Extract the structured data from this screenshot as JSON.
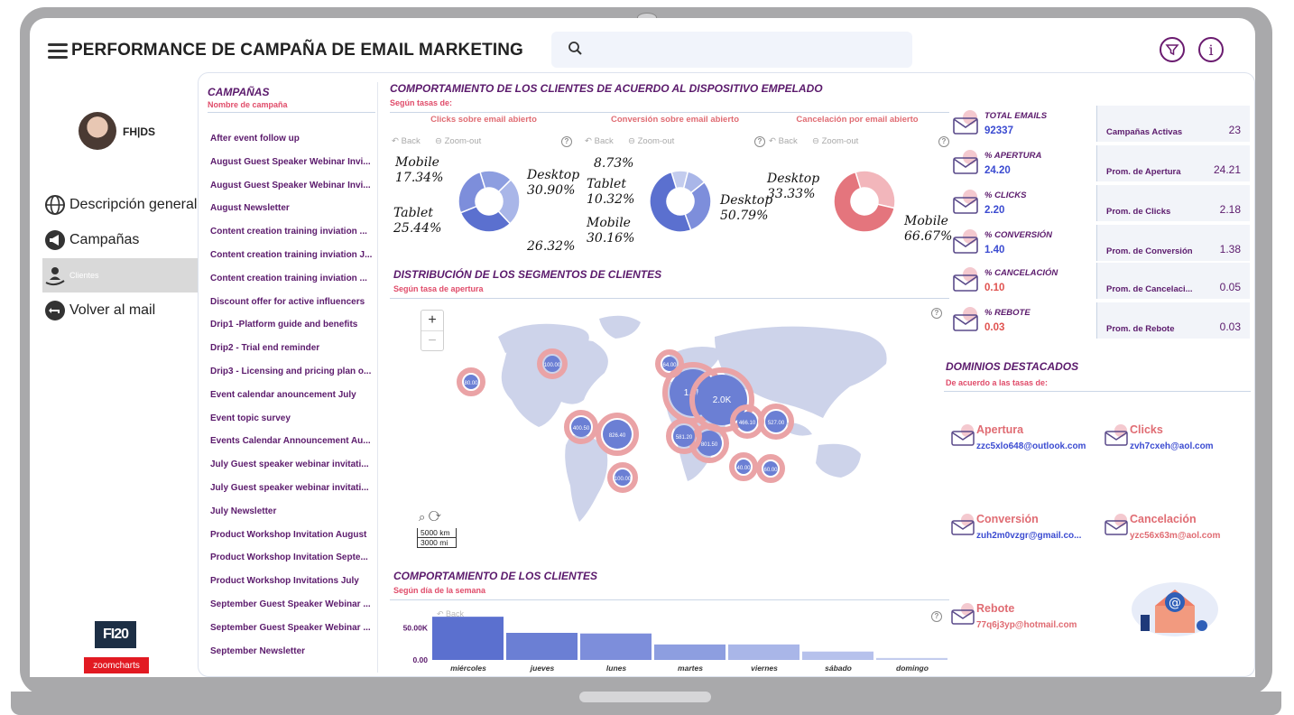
{
  "header": {
    "title": "PERFORMANCE DE CAMPAÑA DE EMAIL MARKETING",
    "search_placeholder": ""
  },
  "user": {
    "name": "FH|DS"
  },
  "nav": [
    {
      "label": "Descripción general",
      "icon": "globe-icon"
    },
    {
      "label": "Campañas",
      "icon": "megaphone-icon"
    },
    {
      "label": "Clientes",
      "icon": "clients-icon",
      "active": true
    },
    {
      "label": "Volver al mail",
      "icon": "back-arrow-icon"
    }
  ],
  "brand": {
    "logo1": "FI20",
    "logo2": "zoomcharts"
  },
  "campaigns": {
    "title": "CAMPAÑAS",
    "subtitle": "Nombre de campaña",
    "items": [
      "After event follow up",
      "August Guest Speaker Webinar Invi...",
      "August Guest Speaker Webinar Invi...",
      "August Newsletter",
      "Content creation training inviation ...",
      "Content creation training inviation J...",
      "Content creation training inviation ...",
      "Discount offer for active influencers",
      "Drip1 -Platform guide and benefits",
      "Drip2 - Trial end reminder",
      "Drip3 - Licensing and pricing plan o...",
      "Event calendar anouncement July",
      "Event topic survey",
      "Events Calendar Announcement Au...",
      "July Guest speaker webinar invitati...",
      "July Guest speaker webinar invitati...",
      "July Newsletter",
      "Product Workshop Invitation August",
      "Product Workshop Invitation Septe...",
      "Product Workshop Invitations July",
      "September Guest Speaker Webinar ...",
      "September Guest Speaker Webinar ...",
      "September Newsletter"
    ]
  },
  "device_section": {
    "title": "COMPORTAMIENTO DE LOS CLIENTES DE ACUERDO AL DISPOSITIVO EMPELADO",
    "subtitle": "Según tasas de:",
    "back_label": "Back",
    "zoom_out_label": "Zoom-out",
    "help": "?",
    "donuts": [
      {
        "heading": "Clicks sobre email abierto",
        "labels": [
          {
            "name": "Mobile",
            "value": "17.34%"
          },
          {
            "name": "Tablet",
            "value": "25.44%"
          },
          {
            "name": "Desktop",
            "value": "30.90%"
          },
          {
            "name": "",
            "value": "26.32%"
          }
        ]
      },
      {
        "heading": "Conversión sobre email abierto",
        "labels": [
          {
            "name": "",
            "value": "8.73%"
          },
          {
            "name": "Tablet",
            "value": "10.32%"
          },
          {
            "name": "Mobile",
            "value": "30.16%"
          },
          {
            "name": "Desktop",
            "value": "50.79%"
          }
        ]
      },
      {
        "heading": "Cancelación por email abierto",
        "labels": [
          {
            "name": "Desktop",
            "value": "33.33%"
          },
          {
            "name": "Mobile",
            "value": "66.67%"
          }
        ]
      }
    ]
  },
  "map_section": {
    "title": "DISTRIBUCIÓN DE LOS SEGMENTOS DE CLIENTES",
    "subtitle": "Según tasa de apertura",
    "zoom_in": "+",
    "zoom_out": "−",
    "scale_km": "5000 km",
    "scale_mi": "3000 mi",
    "bubble_labels": [
      "1.9K",
      "2.0K",
      "826.40",
      "801.50",
      "581.20",
      "527.00",
      "466.10",
      "400.50",
      "100.00",
      "100.00",
      "80.00",
      "64.00",
      "60.00",
      "40.00"
    ]
  },
  "weekday_section": {
    "title": "COMPORTAMIENTO DE LOS CLIENTES",
    "subtitle": "Según día de la semana",
    "back_label": "Back"
  },
  "kpis": [
    {
      "label": "TOTAL EMAILS",
      "value": "92337",
      "card_label": "Campañas Activas",
      "card_value": "23",
      "color": "#3b4bd1"
    },
    {
      "label": "% APERTURA",
      "value": "24.20",
      "card_label": "Prom. de Apertura",
      "card_value": "24.21",
      "color": "#3b4bd1"
    },
    {
      "label": "% CLICKS",
      "value": "2.20",
      "card_label": "Prom. de Clicks",
      "card_value": "2.18",
      "color": "#3b4bd1"
    },
    {
      "label": "% CONVERSIÓN",
      "value": "1.40",
      "card_label": "Prom. de Conversión",
      "card_value": "1.38",
      "color": "#3b4bd1"
    },
    {
      "label": "% CANCELACIÓN",
      "value": "0.10",
      "card_label": "Prom. de Cancelaci...",
      "card_value": "0.05",
      "color": "#e0524f"
    },
    {
      "label": "% REBOTE",
      "value": "0.03",
      "card_label": "Prom. de Rebote",
      "card_value": "0.03",
      "color": "#e0524f"
    }
  ],
  "domains": {
    "title": "DOMINIOS DESTACADOS",
    "subtitle": "De acuerdo a las tasas de:",
    "items": [
      {
        "label": "Apertura",
        "email": "zzc5xlo648@outlook.com",
        "color": "#3b4bd1"
      },
      {
        "label": "Clicks",
        "email": "zvh7cxeh@aol.com",
        "color": "#3b4bd1"
      },
      {
        "label": "Conversión",
        "email": "zuh2m0vzgr@gmail.co...",
        "color": "#3b4bd1"
      },
      {
        "label": "Cancelación",
        "email": "yzc56x63m@aol.com",
        "color": "#e06c73"
      },
      {
        "label": "Rebote",
        "email": "77q6j3yp@hotmail.com",
        "color": "#e06c73"
      }
    ]
  },
  "chart_data": [
    {
      "type": "pie",
      "title": "Clicks sobre email abierto",
      "categories": [
        "Mobile",
        "Tablet",
        "Desktop",
        ""
      ],
      "values": [
        17.34,
        25.44,
        30.9,
        26.32
      ]
    },
    {
      "type": "pie",
      "title": "Conversión sobre email abierto",
      "categories": [
        "",
        "Tablet",
        "Mobile",
        "Desktop"
      ],
      "values": [
        8.73,
        10.32,
        30.16,
        50.79
      ]
    },
    {
      "type": "pie",
      "title": "Cancelación por email abierto",
      "categories": [
        "Desktop",
        "Mobile"
      ],
      "values": [
        33.33,
        66.67
      ]
    },
    {
      "type": "bar",
      "title": "COMPORTAMIENTO DE LOS CLIENTES",
      "categories": [
        "miércoles",
        "jueves",
        "lunes",
        "martes",
        "viernes",
        "sábado",
        "domingo"
      ],
      "values": [
        67000,
        42000,
        41000,
        24000,
        24000,
        13000,
        3000
      ],
      "yticks": [
        "0.00",
        "50.00K"
      ],
      "ylim": [
        0,
        70000
      ]
    }
  ]
}
